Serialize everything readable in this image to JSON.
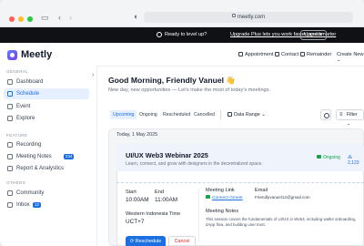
{
  "browser": {
    "url": "meetly.com"
  },
  "banner": {
    "prompt": "Ready to level up?",
    "link_text": "Upgrade Plus lets you work faster, and smarter",
    "button": "Upgrade"
  },
  "app": {
    "name": "Meetly"
  },
  "header_actions": {
    "appointment": "Appointment",
    "contact": "Contact",
    "reminder": "Remainder",
    "create_new": "Create New"
  },
  "sidebar": {
    "general_label": "GENERAL",
    "general_items": [
      {
        "label": "Dashboard",
        "icon": "grid-icon"
      },
      {
        "label": "Schedule",
        "icon": "calendar-icon",
        "active": true
      },
      {
        "label": "Event",
        "icon": "event-icon"
      },
      {
        "label": "Explore",
        "icon": "compass-icon"
      }
    ],
    "feature_label": "FEATURE",
    "feature_items": [
      {
        "label": "Recording",
        "icon": "record-icon"
      },
      {
        "label": "Meeting Notes",
        "icon": "notes-icon",
        "badge": "234"
      },
      {
        "label": "Report & Analystics",
        "icon": "chart-icon"
      }
    ],
    "others_label": "OTHERS",
    "other_items": [
      {
        "label": "Community",
        "icon": "community-icon"
      },
      {
        "label": "Inbox",
        "icon": "inbox-icon",
        "badge": "12"
      }
    ]
  },
  "main": {
    "greeting": "Good Morning, Friendly Vanuel 👋",
    "subtitle": "New day, new opportunities — Let's make the most of today's meetings.",
    "tabs": [
      {
        "label": "Upcoming",
        "active": true
      },
      {
        "label": "Ongoing"
      },
      {
        "label": "Rescheduled"
      },
      {
        "label": "Cancelled"
      }
    ],
    "date_range": "Data Range",
    "filter": "Filter",
    "date_heading": "Today, 1 May 2025"
  },
  "event": {
    "title": "UI/UX Web3 Webinar 2025",
    "description": "Learn, connect, and grow with designers in the decentralized space.",
    "status": "Ongoing",
    "attendees": "2,123",
    "start_label": "Start",
    "start_time": "10:00AM",
    "end_label": "End",
    "end_time": "11:00AM",
    "timezone_label": "Western Indonesia Time",
    "timezone": "UCT+7",
    "meeting_link_label": "Meeting Link",
    "meeting_link": "Connect Gmeet",
    "email_label": "Email",
    "email": "Friendlyvanuel12@gmail.com",
    "notes_label": "Meeting Notes",
    "notes": "This session covers the fundamentals of UI/UX in Web3, including wallet onboarding, dApp flow, and building user trust.",
    "reschedule": "Reschedule",
    "cancel": "Cancel"
  },
  "colors": {
    "accent": "#1b6fe0",
    "success": "#16a34a",
    "danger": "#dc2626"
  }
}
